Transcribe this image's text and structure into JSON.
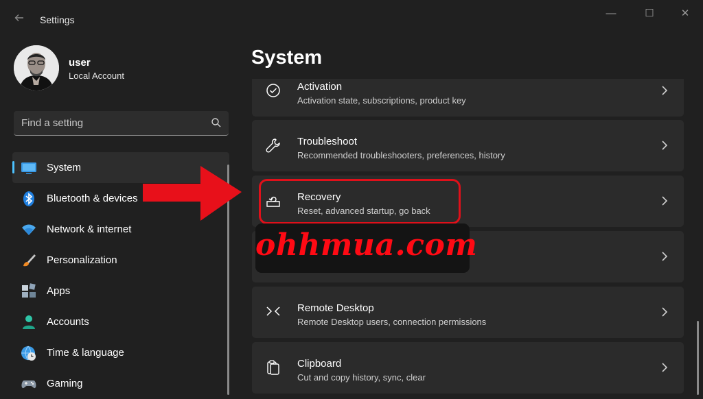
{
  "window": {
    "title": "Settings",
    "controls": {
      "minimize": "—",
      "maximize": "☐",
      "close": "✕"
    }
  },
  "user": {
    "name": "user",
    "account_type": "Local Account"
  },
  "search": {
    "placeholder": "Find a setting"
  },
  "sidebar": {
    "items": [
      {
        "label": "System",
        "icon": "system-monitor-icon",
        "selected": true
      },
      {
        "label": "Bluetooth & devices",
        "icon": "bluetooth-icon"
      },
      {
        "label": "Network & internet",
        "icon": "wifi-icon"
      },
      {
        "label": "Personalization",
        "icon": "brush-icon"
      },
      {
        "label": "Apps",
        "icon": "apps-icon"
      },
      {
        "label": "Accounts",
        "icon": "accounts-icon"
      },
      {
        "label": "Time & language",
        "icon": "globe-clock-icon"
      },
      {
        "label": "Gaming",
        "icon": "gamepad-icon"
      }
    ]
  },
  "main": {
    "title": "System",
    "cards": [
      {
        "title": "Activation",
        "subtitle": "Activation state, subscriptions, product key",
        "icon": "check-circle-icon"
      },
      {
        "title": "Troubleshoot",
        "subtitle": "Recommended troubleshooters, preferences, history",
        "icon": "wrench-icon"
      },
      {
        "title": "Recovery",
        "subtitle": "Reset, advanced startup, go back",
        "icon": "recovery-icon"
      },
      {
        "title": "",
        "subtitle": "",
        "icon": ""
      },
      {
        "title": "Remote Desktop",
        "subtitle": "Remote Desktop users, connection permissions",
        "icon": "remote-desktop-icon"
      },
      {
        "title": "Clipboard",
        "subtitle": "Cut and copy history, sync, clear",
        "icon": "clipboard-icon"
      }
    ]
  },
  "overlay": {
    "watermark": "ohhmua.com"
  },
  "colors": {
    "accent": "#4cc2ff",
    "highlight": "#e0101a",
    "background": "#202020",
    "card": "#2b2b2b"
  }
}
